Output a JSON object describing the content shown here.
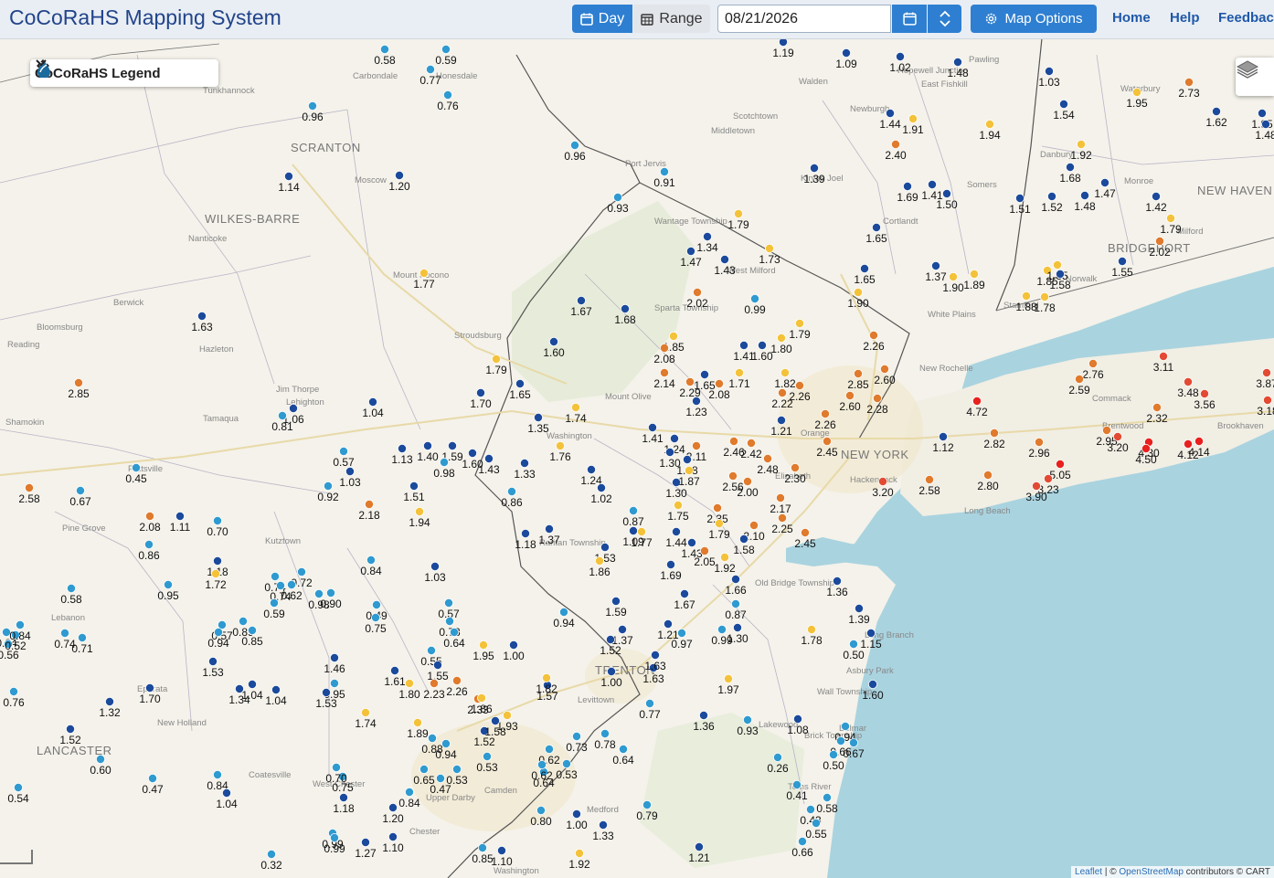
{
  "header": {
    "app_title": "CoCoRaHS Mapping System",
    "day_label": "Day",
    "range_label": "Range",
    "date_value": "08/21/2026",
    "map_options_label": "Map Options",
    "nav": [
      "Home",
      "Help",
      "Feedback"
    ]
  },
  "legend": {
    "label": "CoCoRaHS Legend"
  },
  "attribution": {
    "leaflet": "Leaflet",
    "sep": " | © ",
    "osm": "OpenStreetMap",
    "rest": " contributors © CART"
  },
  "colors": {
    "under_1": "#2f9ad0",
    "1_to_1.5": "#1b4a9c",
    "1.5_to_2": "#f4c23a",
    "2_to_3": "#e07a2c",
    "3_to_4": "#e34a33",
    "over_4": "#e8201e"
  },
  "place_labels": [
    {
      "text": "Carbondale"
    },
    {
      "text": "Honesdale"
    },
    {
      "text": "Tunkhannock"
    },
    {
      "text": "SCRANTON"
    },
    {
      "text": "Moscow"
    },
    {
      "text": "WILKES-BARRE"
    },
    {
      "text": "Nanticoke"
    },
    {
      "text": "Berwick"
    },
    {
      "text": "Bloomsburg"
    },
    {
      "text": "Hazleton"
    },
    {
      "text": "Jim Thorpe"
    },
    {
      "text": "Lehighton"
    },
    {
      "text": "Tamaqua"
    },
    {
      "text": "Shamokin"
    },
    {
      "text": "Pottsville"
    },
    {
      "text": "Pine Grove"
    },
    {
      "text": "Kutztown"
    },
    {
      "text": "Lebanon"
    },
    {
      "text": "Ephrata"
    },
    {
      "text": "New Holland"
    },
    {
      "text": "LANCASTER"
    },
    {
      "text": "Coatesville"
    },
    {
      "text": "West Chester"
    },
    {
      "text": "Chester"
    },
    {
      "text": "Upper Darby"
    },
    {
      "text": "Camden"
    },
    {
      "text": "Medford"
    },
    {
      "text": "Washington"
    },
    {
      "text": "Mount Pocono"
    },
    {
      "text": "Stroudsburg"
    },
    {
      "text": "Port Jervis"
    },
    {
      "text": "Wantage Township"
    },
    {
      "text": "Sparta Township"
    },
    {
      "text": "Mount Olive"
    },
    {
      "text": "Washington"
    },
    {
      "text": "Raritan Township"
    },
    {
      "text": "Old Bridge Township"
    },
    {
      "text": "Levittown"
    },
    {
      "text": "TRENTON"
    },
    {
      "text": "Lakewood"
    },
    {
      "text": "Toms River"
    },
    {
      "text": "Brick Township"
    },
    {
      "text": "Asbury Park"
    },
    {
      "text": "Wall Township"
    },
    {
      "text": "Long Branch"
    },
    {
      "text": "NEW YORK"
    },
    {
      "text": "New Rochelle"
    },
    {
      "text": "White Plains"
    },
    {
      "text": "Long Beach"
    },
    {
      "text": "Commack"
    },
    {
      "text": "Brentwood"
    },
    {
      "text": "Brookhaven"
    },
    {
      "text": "Middletown"
    },
    {
      "text": "Scotchtown"
    },
    {
      "text": "Walden"
    },
    {
      "text": "Newburgh"
    },
    {
      "text": "East Fishkill"
    },
    {
      "text": "Hopewell Junction"
    },
    {
      "text": "Pawling"
    },
    {
      "text": "Danbury"
    },
    {
      "text": "NEW HAVEN"
    },
    {
      "text": "Waterbury"
    },
    {
      "text": "BRIDGEPORT"
    },
    {
      "text": "Norwalk"
    },
    {
      "text": "Stamford"
    },
    {
      "text": "Somers"
    },
    {
      "text": "Cortlandt"
    },
    {
      "text": "Monroe"
    },
    {
      "text": "Milford"
    },
    {
      "text": "Kiryas Joel"
    },
    {
      "text": "West Milford"
    },
    {
      "text": "Orange"
    },
    {
      "text": "Elizabeth"
    },
    {
      "text": "Hackensack"
    },
    {
      "text": "Belmar"
    },
    {
      "text": "Reading"
    }
  ],
  "stations": [
    {
      "v": "0.58",
      "c": "under_1"
    },
    {
      "v": "0.59",
      "c": "under_1"
    },
    {
      "v": "0.77",
      "c": "under_1"
    },
    {
      "v": "0.76",
      "c": "under_1"
    },
    {
      "v": "0.96",
      "c": "under_1"
    },
    {
      "v": "0.96",
      "c": "under_1"
    },
    {
      "v": "1.14",
      "c": "1_to_1.5"
    },
    {
      "v": "1.20",
      "c": "1_to_1.5"
    },
    {
      "v": "0.91",
      "c": "under_1"
    },
    {
      "v": "0.93",
      "c": "under_1"
    },
    {
      "v": "1.19",
      "c": "1_to_1.5"
    },
    {
      "v": "1.09",
      "c": "1_to_1.5"
    },
    {
      "v": "1.02",
      "c": "1_to_1.5"
    },
    {
      "v": "1.48",
      "c": "1_to_1.5"
    },
    {
      "v": "1.03",
      "c": "1_to_1.5"
    },
    {
      "v": "2.73",
      "c": "2_to_3"
    },
    {
      "v": "1.95",
      "c": "1.5_to_2"
    },
    {
      "v": "1.62",
      "c": "1_to_1.5"
    },
    {
      "v": "1.95",
      "c": "1_to_1.5"
    },
    {
      "v": "1.48",
      "c": "1_to_1.5"
    },
    {
      "v": "1.44",
      "c": "1_to_1.5"
    },
    {
      "v": "1.91",
      "c": "1.5_to_2"
    },
    {
      "v": "1.94",
      "c": "1.5_to_2"
    },
    {
      "v": "1.54",
      "c": "1_to_1.5"
    },
    {
      "v": "2.40",
      "c": "2_to_3"
    },
    {
      "v": "1.92",
      "c": "1.5_to_2"
    },
    {
      "v": "1.39",
      "c": "1_to_1.5"
    },
    {
      "v": "1.69",
      "c": "1_to_1.5"
    },
    {
      "v": "1.41",
      "c": "1_to_1.5"
    },
    {
      "v": "1.50",
      "c": "1_to_1.5"
    },
    {
      "v": "1.51",
      "c": "1_to_1.5"
    },
    {
      "v": "1.52",
      "c": "1_to_1.5"
    },
    {
      "v": "1.68",
      "c": "1_to_1.5"
    },
    {
      "v": "1.47",
      "c": "1_to_1.5"
    },
    {
      "v": "1.48",
      "c": "1_to_1.5"
    },
    {
      "v": "1.42",
      "c": "1_to_1.5"
    },
    {
      "v": "1.79",
      "c": "1.5_to_2"
    },
    {
      "v": "2.02",
      "c": "2_to_3"
    },
    {
      "v": "1.79",
      "c": "1.5_to_2"
    },
    {
      "v": "1.65",
      "c": "1_to_1.5"
    },
    {
      "v": "1.34",
      "c": "1_to_1.5"
    },
    {
      "v": "1.47",
      "c": "1_to_1.5"
    },
    {
      "v": "1.43",
      "c": "1_to_1.5"
    },
    {
      "v": "1.73",
      "c": "1.5_to_2"
    },
    {
      "v": "1.65",
      "c": "1_to_1.5"
    },
    {
      "v": "1.37",
      "c": "1_to_1.5"
    },
    {
      "v": "1.90",
      "c": "1.5_to_2"
    },
    {
      "v": "1.89",
      "c": "1.5_to_2"
    },
    {
      "v": "1.85",
      "c": "1.5_to_2"
    },
    {
      "v": "1.85",
      "c": "1.5_to_2"
    },
    {
      "v": "1.58",
      "c": "1_to_1.5"
    },
    {
      "v": "1.55",
      "c": "1_to_1.5"
    },
    {
      "v": "1.77",
      "c": "1.5_to_2"
    },
    {
      "v": "1.90",
      "c": "1.5_to_2"
    },
    {
      "v": "1.88",
      "c": "1.5_to_2"
    },
    {
      "v": "1.78",
      "c": "1.5_to_2"
    },
    {
      "v": "1.67",
      "c": "1_to_1.5"
    },
    {
      "v": "1.68",
      "c": "1_to_1.5"
    },
    {
      "v": "2.02",
      "c": "2_to_3"
    },
    {
      "v": "0.99",
      "c": "under_1"
    },
    {
      "v": "1.63",
      "c": "1_to_1.5"
    },
    {
      "v": "1.60",
      "c": "1_to_1.5"
    },
    {
      "v": "1.85",
      "c": "1.5_to_2"
    },
    {
      "v": "2.08",
      "c": "2_to_3"
    },
    {
      "v": "1.80",
      "c": "1.5_to_2"
    },
    {
      "v": "1.79",
      "c": "1.5_to_2"
    },
    {
      "v": "1.60",
      "c": "1_to_1.5"
    },
    {
      "v": "1.41",
      "c": "1_to_1.5"
    },
    {
      "v": "2.26",
      "c": "2_to_3"
    },
    {
      "v": "1.79",
      "c": "1.5_to_2"
    },
    {
      "v": "1.70",
      "c": "1_to_1.5"
    },
    {
      "v": "1.65",
      "c": "1_to_1.5"
    },
    {
      "v": "1.74",
      "c": "1.5_to_2"
    },
    {
      "v": "2.14",
      "c": "2_to_3"
    },
    {
      "v": "2.29",
      "c": "2_to_3"
    },
    {
      "v": "1.65",
      "c": "1_to_1.5"
    },
    {
      "v": "2.08",
      "c": "2_to_3"
    },
    {
      "v": "1.71",
      "c": "1.5_to_2"
    },
    {
      "v": "1.82",
      "c": "1.5_to_2"
    },
    {
      "v": "2.26",
      "c": "2_to_3"
    },
    {
      "v": "2.22",
      "c": "2_to_3"
    },
    {
      "v": "2.85",
      "c": "2_to_3"
    },
    {
      "v": "2.60",
      "c": "2_to_3"
    },
    {
      "v": "2.28",
      "c": "2_to_3"
    },
    {
      "v": "2.60",
      "c": "2_to_3"
    },
    {
      "v": "2.76",
      "c": "2_to_3"
    },
    {
      "v": "2.59",
      "c": "2_to_3"
    },
    {
      "v": "3.11",
      "c": "3_to_4"
    },
    {
      "v": "3.48",
      "c": "3_to_4"
    },
    {
      "v": "3.56",
      "c": "3_to_4"
    },
    {
      "v": "3.87",
      "c": "3_to_4"
    },
    {
      "v": "3.18",
      "c": "3_to_4"
    },
    {
      "v": "4.72",
      "c": "over_4"
    },
    {
      "v": "2.32",
      "c": "2_to_3"
    },
    {
      "v": "2.85",
      "c": "2_to_3"
    },
    {
      "v": "1.04",
      "c": "1_to_1.5"
    },
    {
      "v": "1.06",
      "c": "1_to_1.5"
    },
    {
      "v": "0.81",
      "c": "under_1"
    },
    {
      "v": "1.13",
      "c": "1_to_1.5"
    },
    {
      "v": "1.40",
      "c": "1_to_1.5"
    },
    {
      "v": "1.59",
      "c": "1_to_1.5"
    },
    {
      "v": "1.60",
      "c": "1_to_1.5"
    },
    {
      "v": "1.43",
      "c": "1_to_1.5"
    },
    {
      "v": "1.35",
      "c": "1_to_1.5"
    },
    {
      "v": "1.41",
      "c": "1_to_1.5"
    },
    {
      "v": "1.24",
      "c": "1_to_1.5"
    },
    {
      "v": "1.23",
      "c": "1_to_1.5"
    },
    {
      "v": "1.21",
      "c": "1_to_1.5"
    },
    {
      "v": "2.26",
      "c": "2_to_3"
    },
    {
      "v": "2.45",
      "c": "2_to_3"
    },
    {
      "v": "2.46",
      "c": "2_to_3"
    },
    {
      "v": "2.42",
      "c": "2_to_3"
    },
    {
      "v": "2.11",
      "c": "2_to_3"
    },
    {
      "v": "1.30",
      "c": "1_to_1.5"
    },
    {
      "v": "1.48",
      "c": "1_to_1.5"
    },
    {
      "v": "1.76",
      "c": "1.5_to_2"
    },
    {
      "v": "1.12",
      "c": "1_to_1.5"
    },
    {
      "v": "2.82",
      "c": "2_to_3"
    },
    {
      "v": "2.96",
      "c": "2_to_3"
    },
    {
      "v": "2.95",
      "c": "2_to_3"
    },
    {
      "v": "3.20",
      "c": "3_to_4"
    },
    {
      "v": "4.30",
      "c": "over_4"
    },
    {
      "v": "4.50",
      "c": "over_4"
    },
    {
      "v": "4.12",
      "c": "over_4"
    },
    {
      "v": "4.14",
      "c": "over_4"
    },
    {
      "v": "5.05",
      "c": "over_4"
    },
    {
      "v": "3.23",
      "c": "3_to_4"
    },
    {
      "v": "3.90",
      "c": "3_to_4"
    },
    {
      "v": "3.20",
      "c": "3_to_4"
    },
    {
      "v": "2.58",
      "c": "2_to_3"
    },
    {
      "v": "2.80",
      "c": "2_to_3"
    },
    {
      "v": "2.58",
      "c": "2_to_3"
    },
    {
      "v": "0.67",
      "c": "under_1"
    },
    {
      "v": "0.45",
      "c": "under_1"
    },
    {
      "v": "0.57",
      "c": "under_1"
    },
    {
      "v": "1.03",
      "c": "1_to_1.5"
    },
    {
      "v": "0.92",
      "c": "under_1"
    },
    {
      "v": "0.98",
      "c": "under_1"
    },
    {
      "v": "1.51",
      "c": "1_to_1.5"
    },
    {
      "v": "1.94",
      "c": "1.5_to_2"
    },
    {
      "v": "1.33",
      "c": "1_to_1.5"
    },
    {
      "v": "0.86",
      "c": "under_1"
    },
    {
      "v": "1.24",
      "c": "1_to_1.5"
    },
    {
      "v": "1.02",
      "c": "1_to_1.5"
    },
    {
      "v": "1.30",
      "c": "1_to_1.5"
    },
    {
      "v": "1.87",
      "c": "1.5_to_2"
    },
    {
      "v": "2.00",
      "c": "2_to_3"
    },
    {
      "v": "2.56",
      "c": "2_to_3"
    },
    {
      "v": "2.48",
      "c": "2_to_3"
    },
    {
      "v": "2.30",
      "c": "2_to_3"
    },
    {
      "v": "2.35",
      "c": "2_to_3"
    },
    {
      "v": "1.75",
      "c": "1.5_to_2"
    },
    {
      "v": "1.79",
      "c": "1.5_to_2"
    },
    {
      "v": "2.17",
      "c": "2_to_3"
    },
    {
      "v": "2.25",
      "c": "2_to_3"
    },
    {
      "v": "2.45",
      "c": "2_to_3"
    },
    {
      "v": "2.10",
      "c": "2_to_3"
    },
    {
      "v": "1.58",
      "c": "1_to_1.5"
    },
    {
      "v": "2.18",
      "c": "2_to_3"
    },
    {
      "v": "2.08",
      "c": "2_to_3"
    },
    {
      "v": "1.11",
      "c": "1_to_1.5"
    },
    {
      "v": "0.70",
      "c": "under_1"
    },
    {
      "v": "0.86",
      "c": "under_1"
    },
    {
      "v": "1.18",
      "c": "1_to_1.5"
    },
    {
      "v": "1.37",
      "c": "1_to_1.5"
    },
    {
      "v": "0.87",
      "c": "under_1"
    },
    {
      "v": "1.09",
      "c": "1_to_1.5"
    },
    {
      "v": "1.77",
      "c": "1.5_to_2"
    },
    {
      "v": "1.44",
      "c": "1_to_1.5"
    },
    {
      "v": "1.43",
      "c": "1_to_1.5"
    },
    {
      "v": "2.05",
      "c": "2_to_3"
    },
    {
      "v": "1.92",
      "c": "1.5_to_2"
    },
    {
      "v": "1.53",
      "c": "1_to_1.5"
    },
    {
      "v": "1.86",
      "c": "1.5_to_2"
    },
    {
      "v": "1.69",
      "c": "1_to_1.5"
    },
    {
      "v": "1.66",
      "c": "1_to_1.5"
    },
    {
      "v": "1.36",
      "c": "1_to_1.5"
    },
    {
      "v": "1.18",
      "c": "1_to_1.5"
    },
    {
      "v": "1.72",
      "c": "1.5_to_2"
    },
    {
      "v": "0.95",
      "c": "under_1"
    },
    {
      "v": "0.84",
      "c": "under_1"
    },
    {
      "v": "1.03",
      "c": "1_to_1.5"
    },
    {
      "v": "0.74",
      "c": "under_1"
    },
    {
      "v": "0.74",
      "c": "under_1"
    },
    {
      "v": "0.72",
      "c": "under_1"
    },
    {
      "v": "0.62",
      "c": "under_1"
    },
    {
      "v": "0.90",
      "c": "under_1"
    },
    {
      "v": "0.59",
      "c": "under_1"
    },
    {
      "v": "0.98",
      "c": "under_1"
    },
    {
      "v": "0.49",
      "c": "under_1"
    },
    {
      "v": "0.75",
      "c": "under_1"
    },
    {
      "v": "0.57",
      "c": "under_1"
    },
    {
      "v": "0.73",
      "c": "under_1"
    },
    {
      "v": "0.58",
      "c": "under_1"
    },
    {
      "v": "0.74",
      "c": "under_1"
    },
    {
      "v": "0.71",
      "c": "under_1"
    },
    {
      "v": "0.57",
      "c": "under_1"
    },
    {
      "v": "0.89",
      "c": "under_1"
    },
    {
      "v": "0.85",
      "c": "under_1"
    },
    {
      "v": "0.94",
      "c": "under_1"
    },
    {
      "v": "0.84",
      "c": "under_1"
    },
    {
      "v": "0.56",
      "c": "under_1"
    },
    {
      "v": "1.53",
      "c": "1_to_1.5"
    },
    {
      "v": "1.59",
      "c": "1_to_1.5"
    },
    {
      "v": "1.67",
      "c": "1_to_1.5"
    },
    {
      "v": "0.87",
      "c": "under_1"
    },
    {
      "v": "1.21",
      "c": "1_to_1.5"
    },
    {
      "v": "0.97",
      "c": "under_1"
    },
    {
      "v": "0.99",
      "c": "under_1"
    },
    {
      "v": "1.30",
      "c": "1_to_1.5"
    },
    {
      "v": "1.37",
      "c": "1_to_1.5"
    },
    {
      "v": "1.52",
      "c": "1_to_1.5"
    },
    {
      "v": "1.78",
      "c": "1.5_to_2"
    },
    {
      "v": "1.39",
      "c": "1_to_1.5"
    },
    {
      "v": "1.15",
      "c": "1_to_1.5"
    },
    {
      "v": "0.50",
      "c": "under_1"
    },
    {
      "v": "0.94",
      "c": "under_1"
    },
    {
      "v": "0.64",
      "c": "under_1"
    },
    {
      "v": "0.55",
      "c": "under_1"
    },
    {
      "v": "1.55",
      "c": "1_to_1.5"
    },
    {
      "v": "1.95",
      "c": "1.5_to_2"
    },
    {
      "v": "1.00",
      "c": "1_to_1.5"
    },
    {
      "v": "1.46",
      "c": "1_to_1.5"
    },
    {
      "v": "1.61",
      "c": "1_to_1.5"
    },
    {
      "v": "0.95",
      "c": "under_1"
    },
    {
      "v": "1.80",
      "c": "1.5_to_2"
    },
    {
      "v": "2.26",
      "c": "2_to_3"
    },
    {
      "v": "2.23",
      "c": "2_to_3"
    },
    {
      "v": "2.33",
      "c": "2_to_3"
    },
    {
      "v": "1.86",
      "c": "1.5_to_2"
    },
    {
      "v": "1.57",
      "c": "1_to_1.5"
    },
    {
      "v": "1.82",
      "c": "1.5_to_2"
    },
    {
      "v": "1.00",
      "c": "1_to_1.5"
    },
    {
      "v": "1.63",
      "c": "1_to_1.5"
    },
    {
      "v": "1.97",
      "c": "1.5_to_2"
    },
    {
      "v": "1.63",
      "c": "1_to_1.5"
    },
    {
      "v": "1.60",
      "c": "1_to_1.5"
    },
    {
      "v": "0.76",
      "c": "under_1"
    },
    {
      "v": "1.70",
      "c": "1_to_1.5"
    },
    {
      "v": "1.34",
      "c": "1_to_1.5"
    },
    {
      "v": "1.04",
      "c": "1_to_1.5"
    },
    {
      "v": "1.04",
      "c": "1_to_1.5"
    },
    {
      "v": "1.53",
      "c": "1_to_1.5"
    },
    {
      "v": "1.74",
      "c": "1.5_to_2"
    },
    {
      "v": "1.89",
      "c": "1.5_to_2"
    },
    {
      "v": "1.93",
      "c": "1.5_to_2"
    },
    {
      "v": "1.52",
      "c": "1_to_1.5"
    },
    {
      "v": "1.58",
      "c": "1_to_1.5"
    },
    {
      "v": "1.32",
      "c": "1_to_1.5"
    },
    {
      "v": "1.52",
      "c": "1_to_1.5"
    },
    {
      "v": "0.88",
      "c": "under_1"
    },
    {
      "v": "0.94",
      "c": "under_1"
    },
    {
      "v": "0.62",
      "c": "under_1"
    },
    {
      "v": "0.73",
      "c": "under_1"
    },
    {
      "v": "0.78",
      "c": "under_1"
    },
    {
      "v": "0.64",
      "c": "under_1"
    },
    {
      "v": "0.77",
      "c": "under_1"
    },
    {
      "v": "1.36",
      "c": "1_to_1.5"
    },
    {
      "v": "0.93",
      "c": "under_1"
    },
    {
      "v": "1.08",
      "c": "1_to_1.5"
    },
    {
      "v": "0.94",
      "c": "under_1"
    },
    {
      "v": "0.66",
      "c": "under_1"
    },
    {
      "v": "0.67",
      "c": "under_1"
    },
    {
      "v": "0.50",
      "c": "under_1"
    },
    {
      "v": "0.26",
      "c": "under_1"
    },
    {
      "v": "0.41",
      "c": "under_1"
    },
    {
      "v": "0.58",
      "c": "under_1"
    },
    {
      "v": "0.43",
      "c": "under_1"
    },
    {
      "v": "0.55",
      "c": "under_1"
    },
    {
      "v": "0.66",
      "c": "under_1"
    },
    {
      "v": "0.60",
      "c": "under_1"
    },
    {
      "v": "0.47",
      "c": "under_1"
    },
    {
      "v": "0.84",
      "c": "under_1"
    },
    {
      "v": "1.04",
      "c": "1_to_1.5"
    },
    {
      "v": "0.75",
      "c": "under_1"
    },
    {
      "v": "0.70",
      "c": "under_1"
    },
    {
      "v": "1.18",
      "c": "1_to_1.5"
    },
    {
      "v": "0.65",
      "c": "under_1"
    },
    {
      "v": "0.47",
      "c": "under_1"
    },
    {
      "v": "0.53",
      "c": "under_1"
    },
    {
      "v": "0.53",
      "c": "under_1"
    },
    {
      "v": "0.64",
      "c": "under_1"
    },
    {
      "v": "0.62",
      "c": "under_1"
    },
    {
      "v": "0.53",
      "c": "under_1"
    },
    {
      "v": "0.99",
      "c": "under_1"
    },
    {
      "v": "0.84",
      "c": "under_1"
    },
    {
      "v": "1.20",
      "c": "1_to_1.5"
    },
    {
      "v": "0.80",
      "c": "under_1"
    },
    {
      "v": "1.00",
      "c": "1_to_1.5"
    },
    {
      "v": "1.33",
      "c": "1_to_1.5"
    },
    {
      "v": "0.79",
      "c": "under_1"
    },
    {
      "v": "0.54",
      "c": "under_1"
    },
    {
      "v": "0.99",
      "c": "under_1"
    },
    {
      "v": "1.10",
      "c": "1_to_1.5"
    },
    {
      "v": "1.27",
      "c": "1_to_1.5"
    },
    {
      "v": "0.32",
      "c": "under_1"
    },
    {
      "v": "0.85",
      "c": "under_1"
    },
    {
      "v": "1.10",
      "c": "1_to_1.5"
    },
    {
      "v": "1.92",
      "c": "1.5_to_2"
    },
    {
      "v": "1.21",
      "c": "1_to_1.5"
    },
    {
      "v": "0.52",
      "c": "under_1"
    },
    {
      "v": "0.84",
      "c": "under_1"
    }
  ]
}
